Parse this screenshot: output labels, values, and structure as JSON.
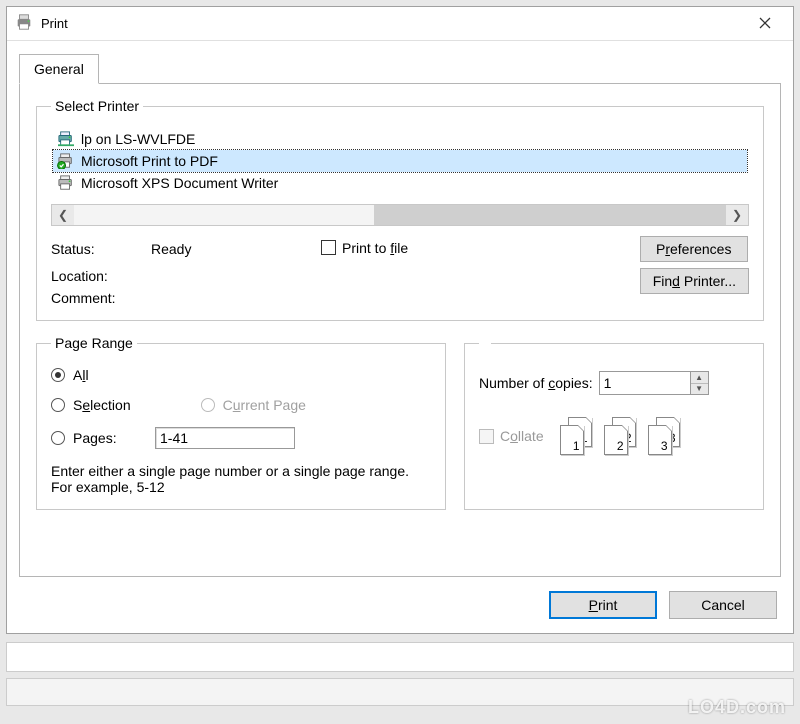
{
  "window": {
    "title": "Print",
    "tab_general": "General"
  },
  "select_printer": {
    "legend": "Select Printer",
    "items": [
      {
        "label": "lp on LS-WVLFDE",
        "selected": false,
        "default": false
      },
      {
        "label": "Microsoft Print to PDF",
        "selected": true,
        "default": true
      },
      {
        "label": "Microsoft XPS Document Writer",
        "selected": false,
        "default": false
      }
    ],
    "status_label": "Status:",
    "status_value": "Ready",
    "location_label": "Location:",
    "location_value": "",
    "comment_label": "Comment:",
    "comment_value": "",
    "print_to_file_label": "Print to file",
    "print_to_file_checked": false,
    "preferences_btn": "Preferences",
    "find_printer_btn": "Find Printer..."
  },
  "page_range": {
    "legend": "Page Range",
    "all_label": "All",
    "selection_label": "Selection",
    "current_page_label": "Current Page",
    "pages_label": "Pages:",
    "pages_value": "1-41",
    "selected": "all",
    "hint": "Enter either a single page number or a single page range.  For example, 5-12"
  },
  "copies": {
    "number_label_pre": "Number of ",
    "number_label_u": "c",
    "number_label_post": "opies:",
    "number_value": "1",
    "collate_label": "Collate",
    "collate_enabled": false,
    "pairs": [
      "1",
      "2",
      "3"
    ]
  },
  "buttons": {
    "print_pre": "",
    "print_u": "P",
    "print_post": "rint",
    "cancel": "Cancel"
  },
  "watermark": "LO4D.com"
}
